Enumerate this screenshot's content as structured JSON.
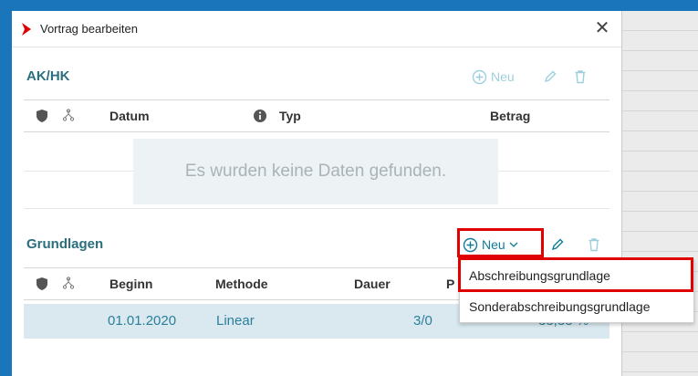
{
  "dialog": {
    "title": "Vortrag bearbeiten",
    "close_icon": "close-icon",
    "accent": "#e10000",
    "primary": "#117a96"
  },
  "akhk": {
    "title": "AK/HK",
    "new_label": "Neu",
    "columns": {
      "datum": "Datum",
      "typ": "Typ",
      "betrag": "Betrag"
    },
    "empty_text": "Es wurden keine Daten gefunden."
  },
  "grundlagen": {
    "title": "Grundlagen",
    "new_label": "Neu",
    "columns": {
      "beginn": "Beginn",
      "methode": "Methode",
      "dauer": "Dauer",
      "p": "P"
    },
    "row": {
      "beginn": "01.01.2020",
      "methode": "Linear",
      "dauer": "3/0",
      "pct": "33,33 %"
    }
  },
  "dropdown": {
    "items": [
      "Abschreibungsgrundlage",
      "Sonderabschreibungsgrundlage"
    ],
    "highlighted": "Abschreibungsgrundlage"
  }
}
